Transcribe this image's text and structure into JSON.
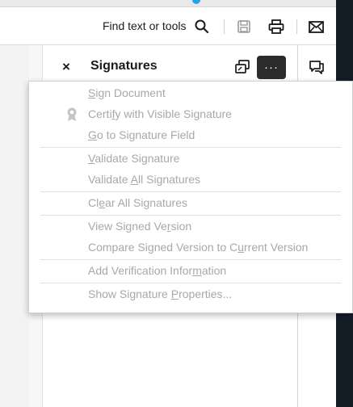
{
  "toolbar": {
    "find_label": "Find text or tools",
    "icons": [
      "search-icon",
      "save-icon",
      "print-icon",
      "email-icon"
    ]
  },
  "panel": {
    "close_glyph": "×",
    "title": "Signatures",
    "more_glyph": "···"
  },
  "menu": {
    "items": [
      {
        "id": "sign-document",
        "pre": "",
        "key": "S",
        "post": "ign Document",
        "enabled": false
      },
      {
        "id": "certify-visible",
        "pre": "Certi",
        "key": "f",
        "post": "y with Visible Signature",
        "enabled": false
      },
      {
        "id": "go-to-field",
        "pre": "",
        "key": "G",
        "post": "o to Signature Field",
        "enabled": false
      },
      {
        "id": "validate-signature",
        "pre": "",
        "key": "V",
        "post": "alidate Signature",
        "enabled": false
      },
      {
        "id": "validate-all",
        "pre": "Validate ",
        "key": "A",
        "post": "ll Signatures",
        "enabled": false
      },
      {
        "id": "clear-all",
        "pre": "Cl",
        "key": "e",
        "post": "ar All Signatures",
        "enabled": false
      },
      {
        "id": "view-signed",
        "pre": "View Signed Ve",
        "key": "r",
        "post": "sion",
        "enabled": false
      },
      {
        "id": "compare-signed",
        "pre": "Compare Signed Version to C",
        "key": "u",
        "post": "rrent Version",
        "enabled": false
      },
      {
        "id": "add-verification",
        "pre": "Add Verification Infor",
        "key": "m",
        "post": "ation",
        "enabled": false
      },
      {
        "id": "show-properties",
        "pre": "Show Signature ",
        "key": "P",
        "post": "roperties...",
        "enabled": false
      }
    ]
  },
  "colors": {
    "disabled_text": "#a8a8a8",
    "more_button_bg": "#2b2b2b",
    "accent": "#1ea5f2",
    "dark_edge": "#141c26"
  }
}
